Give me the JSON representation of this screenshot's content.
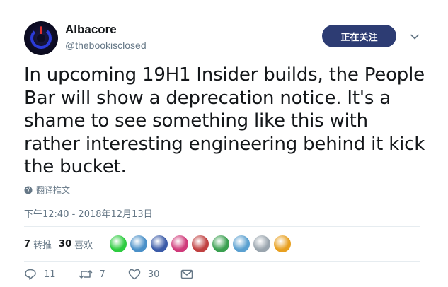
{
  "author": {
    "display_name": "Albacore",
    "handle": "@thebookisclosed"
  },
  "follow_button": {
    "label": "正在关注"
  },
  "tweet": {
    "text": "In upcoming 19H1 Insider builds, the People Bar will show a deprecation notice. It's a shame to see something like this with rather interesting engineering behind it kick the bucket.",
    "translate_label": "翻译推文",
    "timestamp": "下午12:40 - 2018年12月13日"
  },
  "stats": {
    "retweets_count": "7",
    "retweets_label": "转推",
    "likes_count": "30",
    "likes_label": "喜欢"
  },
  "likers": [
    {
      "icon": "green-r-avatar",
      "color": "#2ecc40"
    },
    {
      "icon": "blue-flame-avatar",
      "color": "#4a90c8"
    },
    {
      "icon": "person-avatar",
      "color": "#3b5ba8"
    },
    {
      "icon": "colorful-circle-avatar",
      "color": "#d03a7a"
    },
    {
      "icon": "person-red-avatar",
      "color": "#c04040"
    },
    {
      "icon": "character-avatar",
      "color": "#3aa050"
    },
    {
      "icon": "blue-white-avatar",
      "color": "#5aa0d0"
    },
    {
      "icon": "default-person-avatar",
      "color": "#9aa5ae"
    },
    {
      "icon": "cartoon-avatar",
      "color": "#e8a020"
    }
  ],
  "actions": {
    "reply_count": "11",
    "retweet_count": "7",
    "like_count": "30"
  },
  "colors": {
    "follow_bg": "#2d3c73",
    "secondary_text": "#657786",
    "primary_text": "#14171a",
    "divider": "#e6ecf0"
  }
}
